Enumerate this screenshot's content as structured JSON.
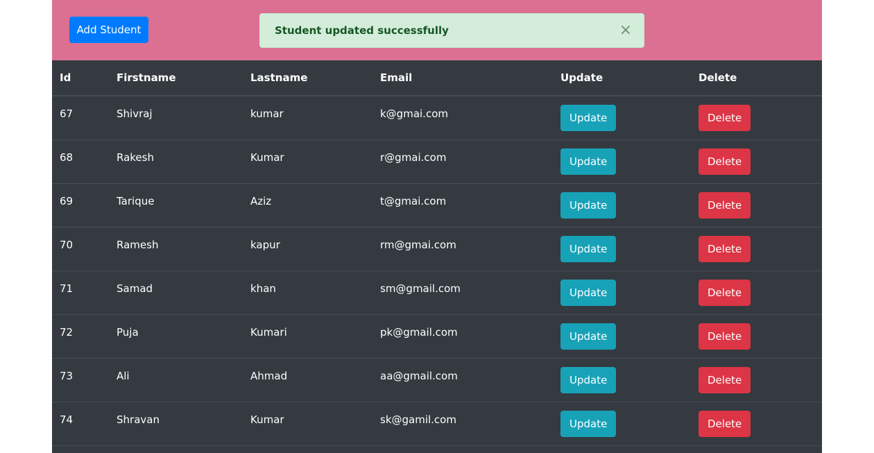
{
  "toolbar": {
    "add_label": "Add Student"
  },
  "alert": {
    "message": "Student updated successfully",
    "close_glyph": "×"
  },
  "table": {
    "headers": [
      "Id",
      "Firstname",
      "Lastname",
      "Email",
      "Update",
      "Delete"
    ],
    "update_label": "Update",
    "delete_label": "Delete",
    "rows": [
      {
        "id": "67",
        "first": "Shivraj",
        "last": "kumar",
        "email": "k@gmai.com"
      },
      {
        "id": "68",
        "first": "Rakesh",
        "last": "Kumar",
        "email": "r@gmai.com"
      },
      {
        "id": "69",
        "first": "Tarique",
        "last": "Aziz",
        "email": "t@gmai.com"
      },
      {
        "id": "70",
        "first": "Ramesh",
        "last": "kapur",
        "email": "rm@gmai.com"
      },
      {
        "id": "71",
        "first": "Samad",
        "last": "khan",
        "email": "sm@gmail.com"
      },
      {
        "id": "72",
        "first": "Puja",
        "last": "Kumari",
        "email": "pk@gmail.com"
      },
      {
        "id": "73",
        "first": "Ali",
        "last": "Ahmad",
        "email": "aa@gmail.com"
      },
      {
        "id": "74",
        "first": "Shravan",
        "last": "Kumar",
        "email": "sk@gamil.com"
      }
    ]
  },
  "colors": {
    "topbar": "#db7093",
    "table_bg": "#343a40",
    "add_button": "#007bff",
    "alert_bg": "#d4edda",
    "alert_text": "#155724",
    "update_button": "#17a2b8",
    "delete_button": "#dc3545"
  }
}
